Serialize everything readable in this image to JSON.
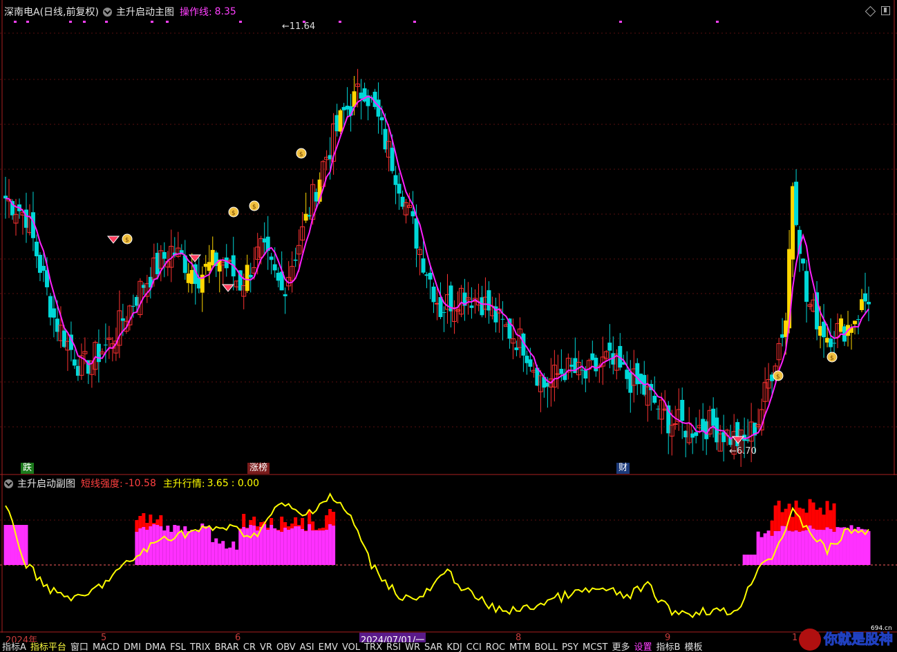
{
  "main_title": {
    "stock": "深南电A(日线,前复权)",
    "indicator": "主升启动主图",
    "line_label": "操作线:",
    "line_value": "8.35"
  },
  "sub_title": {
    "indicator": "主升启动副图",
    "short_label": "短线强度:",
    "short_value": "-10.58",
    "main_label": "主升行情:",
    "main_value": "3.65",
    "extra_value": ": 0.00"
  },
  "annotations": {
    "high_label": "11.64",
    "low_label": "6.70",
    "tag_fall": "跌",
    "tag_limit": "涨榜",
    "tag_finance": "财"
  },
  "x_axis": {
    "labels": [
      "2024年",
      "5",
      "6",
      "2024/07/01/一",
      "8",
      "9",
      "1"
    ]
  },
  "tabs": [
    "指标A",
    "指标平台",
    "窗口",
    "MACD",
    "DMI",
    "DMA",
    "FSL",
    "TRIX",
    "BRAR",
    "CR",
    "VR",
    "OBV",
    "ASI",
    "EMV",
    "VOL",
    "TRX",
    "RSI",
    "WR",
    "SAR",
    "KDJ",
    "CCI",
    "ROC",
    "MTM",
    "BOLL",
    "PSY",
    "MCST",
    "更多",
    "设置",
    "指标B",
    "模板"
  ],
  "watermark": {
    "text": "你就是股神",
    "site": "694.cn"
  },
  "colors": {
    "up": "#ff3232",
    "down": "#00d8d8",
    "strong": "#ffd700",
    "ma": "#ff20ff",
    "short_line": "#ffff00",
    "bar_magenta": "#ff30ff",
    "bar_red": "#ff0000"
  },
  "chart_data": {
    "type": "candlestick",
    "y_range": [
      6.7,
      11.64
    ],
    "high": 11.64,
    "low": 6.7,
    "operation_line": 8.35,
    "sub_indicator": {
      "short_strength": -10.58,
      "main_trend": 3.65,
      "extra": 0.0
    }
  }
}
